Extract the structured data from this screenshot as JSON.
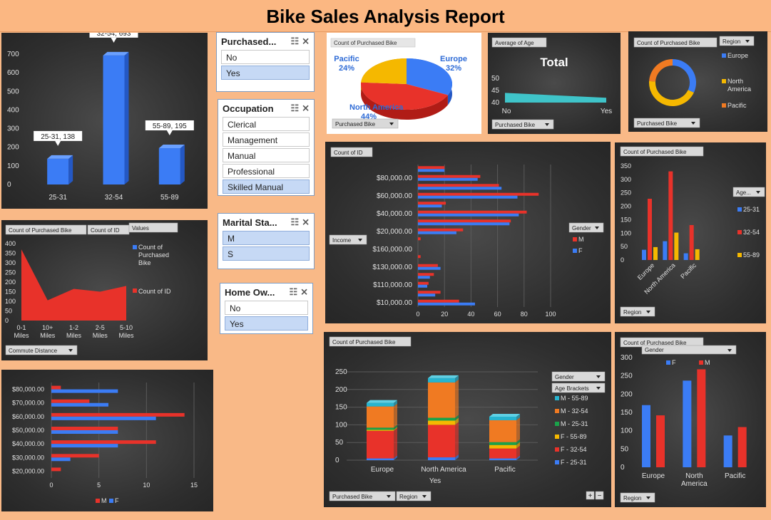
{
  "title": "Bike Sales Analysis Report",
  "slicers": [
    {
      "name": "purchased",
      "title": "Purchased...",
      "items": [
        {
          "label": "No",
          "sel": false
        },
        {
          "label": "Yes",
          "sel": true
        }
      ]
    },
    {
      "name": "occupation",
      "title": "Occupation",
      "items": [
        {
          "label": "Clerical",
          "sel": false
        },
        {
          "label": "Management",
          "sel": false
        },
        {
          "label": "Manual",
          "sel": false
        },
        {
          "label": "Professional",
          "sel": false
        },
        {
          "label": "Skilled Manual",
          "sel": true
        }
      ]
    },
    {
      "name": "marital",
      "title": "Marital Sta...",
      "items": [
        {
          "label": "M",
          "sel": true
        },
        {
          "label": "S",
          "sel": true
        }
      ]
    },
    {
      "name": "home",
      "title": "Home Ow...",
      "items": [
        {
          "label": "No",
          "sel": false
        },
        {
          "label": "Yes",
          "sel": true
        }
      ]
    }
  ],
  "chart_data": [
    {
      "id": "age_bar",
      "type": "bar",
      "categories": [
        "25-31",
        "32-54",
        "55-89"
      ],
      "values": [
        138,
        693,
        195
      ],
      "data_labels": [
        "25-31, 138",
        "32-54, 693",
        "55-89, 195"
      ],
      "ylim": [
        0,
        700
      ],
      "yticks": [
        0,
        100,
        200,
        300,
        400,
        500,
        600,
        700
      ],
      "color": "#3b7cf5"
    },
    {
      "id": "commute_area",
      "type": "area",
      "categories": [
        "0-1 Miles",
        "10+ Miles",
        "1-2 Miles",
        "2-5 Miles",
        "5-10 Miles"
      ],
      "values": [
        370,
        105,
        165,
        150,
        180
      ],
      "ylim": [
        0,
        400
      ],
      "yticks": [
        0,
        50,
        100,
        150,
        200,
        250,
        300,
        350,
        400
      ],
      "field_buttons": [
        "Count of Purchased Bike",
        "Count of ID",
        "Values"
      ],
      "legend": [
        "Count of Purchased Bike",
        "Count of ID"
      ],
      "axis_button": "Commute Distance",
      "color": "#e8322a"
    },
    {
      "id": "income_gender_small",
      "type": "bar",
      "orientation": "horizontal",
      "categories": [
        "$20,000.00",
        "$30,000.00",
        "$40,000.00",
        "$50,000.00",
        "$60,000.00",
        "$70,000.00",
        "$80,000.00"
      ],
      "series": [
        {
          "name": "M",
          "values": [
            1,
            5,
            11,
            7,
            14,
            4,
            1
          ],
          "color": "#e8322a"
        },
        {
          "name": "F",
          "values": [
            0,
            2,
            7,
            7,
            11,
            6,
            7
          ],
          "color": "#3b7cf5"
        }
      ],
      "xlim": [
        0,
        15
      ],
      "xticks": [
        0,
        5,
        10,
        15
      ],
      "legend": [
        "M",
        "F"
      ]
    },
    {
      "id": "region_pie",
      "type": "pie",
      "field_button": "Count of Purchased Bike",
      "labels": [
        {
          "name": "Europe",
          "pct": "32%"
        },
        {
          "name": "North America",
          "pct": "44%"
        },
        {
          "name": "Pacific",
          "pct": "24%"
        }
      ],
      "values": [
        32,
        44,
        24
      ],
      "colors": [
        "#3b7cf5",
        "#e8322a",
        "#f5b800"
      ],
      "filter_button": "Purchased Bike"
    },
    {
      "id": "avg_age",
      "type": "area",
      "field_button": "Average of Age",
      "title": "Total",
      "categories": [
        "No",
        "Yes"
      ],
      "values": [
        44,
        42
      ],
      "ylim": [
        40,
        50
      ],
      "yticks": [
        40,
        45,
        50
      ],
      "filter_button": "Purchased Bike",
      "color": "#3fc4c9"
    },
    {
      "id": "region_donut",
      "type": "pie",
      "field_button": "Count of Purchased Bike",
      "region_button": "Region",
      "legend": [
        "Europe",
        "North America",
        "Pacific"
      ],
      "values": [
        32,
        44,
        24
      ],
      "colors": [
        "#3b7cf5",
        "#f5b800",
        "#f07a22"
      ],
      "filter_button": "Purchased Bike"
    },
    {
      "id": "income_gender",
      "type": "bar",
      "orientation": "horizontal",
      "field_button": "Count of ID",
      "axis_button": "Income",
      "legend_button": "Gender",
      "legend": [
        "M",
        "F"
      ],
      "categories": [
        "$10,000.00",
        "",
        "$110,000.00",
        "",
        "$130,000.00",
        "",
        "$160,000.00",
        "",
        "$20,000.00",
        "",
        "$40,000.00",
        "",
        "$60,000.00",
        "",
        "$80,000.00"
      ],
      "series": [
        {
          "name": "M",
          "values": [
            31,
            17,
            8,
            12,
            15,
            2,
            0,
            2,
            34,
            70,
            82,
            21,
            91,
            61,
            47,
            20
          ],
          "color": "#e8322a"
        },
        {
          "name": "F",
          "values": [
            43,
            13,
            7,
            9,
            17,
            0,
            0,
            0,
            29,
            69,
            76,
            18,
            75,
            63,
            45,
            20
          ],
          "color": "#3b7cf5"
        }
      ],
      "xlim": [
        0,
        100
      ],
      "xticks": [
        0,
        20,
        40,
        60,
        80,
        100
      ]
    },
    {
      "id": "region_age",
      "type": "bar",
      "field_button": "Count of Purchased Bike",
      "legend_button": "Age...",
      "axis_button": "Region",
      "categories": [
        "Europe",
        "North America",
        "Pacific"
      ],
      "series": [
        {
          "name": "25-31",
          "values": [
            38,
            70,
            25
          ],
          "color": "#3b7cf5"
        },
        {
          "name": "32-54",
          "values": [
            228,
            330,
            130
          ],
          "color": "#e8322a"
        },
        {
          "name": "55-89",
          "values": [
            48,
            102,
            40
          ],
          "color": "#f5b800"
        }
      ],
      "ylim": [
        0,
        350
      ],
      "yticks": [
        0,
        50,
        100,
        150,
        200,
        250,
        300,
        350
      ]
    },
    {
      "id": "region_stack",
      "type": "bar",
      "stacked": true,
      "field_button": "Count of Purchased Bike",
      "legend_buttons": [
        "Gender",
        "Age Brackets"
      ],
      "xlabel": "Yes",
      "categories": [
        "Europe",
        "North America",
        "Pacific"
      ],
      "series": [
        {
          "name": "F - 25-31",
          "values": [
            5,
            8,
            5
          ],
          "color": "#3b7cf5"
        },
        {
          "name": "F - 32-54",
          "values": [
            78,
            92,
            28
          ],
          "color": "#e8322a"
        },
        {
          "name": "F - 55-89",
          "values": [
            3,
            12,
            10
          ],
          "color": "#f5b800"
        },
        {
          "name": "M - 25-31",
          "values": [
            6,
            8,
            8
          ],
          "color": "#1aa34a"
        },
        {
          "name": "M - 32-54",
          "values": [
            60,
            100,
            62
          ],
          "color": "#f07a22"
        },
        {
          "name": "M - 55-89",
          "values": [
            10,
            12,
            10
          ],
          "color": "#27b4cf"
        }
      ],
      "legend": [
        "M - 55-89",
        "M - 32-54",
        "M - 25-31",
        "F - 55-89",
        "F - 32-54",
        "F - 25-31"
      ],
      "ylim": [
        0,
        250
      ],
      "yticks": [
        0,
        50,
        100,
        150,
        200,
        250
      ],
      "filter_buttons": [
        "Purchased Bike",
        "Region"
      ]
    },
    {
      "id": "region_gender",
      "type": "bar",
      "field_button": "Count of Purchased Bike",
      "legend_button": "Gender",
      "legend": [
        "F",
        "M"
      ],
      "categories": [
        "Europe",
        "North America",
        "Pacific"
      ],
      "series": [
        {
          "name": "F",
          "values": [
            170,
            237,
            87
          ],
          "color": "#3b7cf5"
        },
        {
          "name": "M",
          "values": [
            142,
            268,
            110
          ],
          "color": "#e8322a"
        }
      ],
      "ylim": [
        0,
        300
      ],
      "yticks": [
        0,
        50,
        100,
        150,
        200,
        250,
        300
      ],
      "axis_button": "Region"
    }
  ]
}
